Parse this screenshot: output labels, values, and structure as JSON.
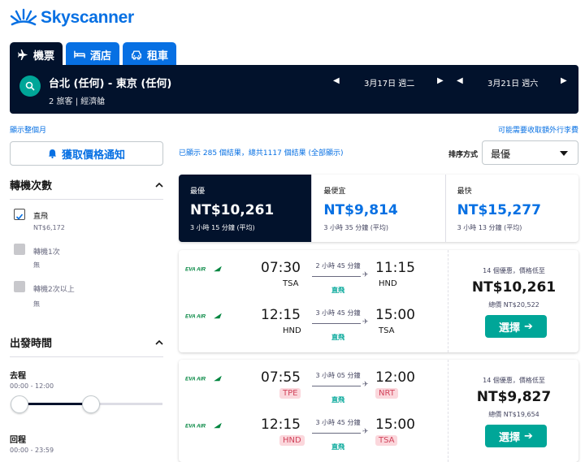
{
  "brand": {
    "name": "Skyscanner"
  },
  "tabs": [
    {
      "label": "機票",
      "icon": "plane-icon"
    },
    {
      "label": "酒店",
      "icon": "bed-icon"
    },
    {
      "label": "租車",
      "icon": "car-icon"
    }
  ],
  "search": {
    "route": "台北 (任何) - 東京 (任何)",
    "passengers": "2 旅客 | 經濟艙",
    "depart_date": "3月17日 週二",
    "return_date": "3月21日 週六"
  },
  "links": {
    "month_view": "顯示整個月",
    "extra_fees": "可能需要收取額外行李費"
  },
  "sidebar": {
    "price_alert": "獲取價格通知",
    "stops": {
      "title": "轉機次數",
      "options": [
        {
          "label": "直飛",
          "sub": "NT$6,172",
          "checked": true
        },
        {
          "label": "轉機1次",
          "sub": "無",
          "checked": false
        },
        {
          "label": "轉機2次以上",
          "sub": "無",
          "checked": false
        }
      ]
    },
    "times": {
      "title": "出發時間",
      "outbound_label": "去程",
      "outbound_range": "00:00 - 12:00",
      "outbound_fraction": 0.5,
      "return_label": "回程",
      "return_range": "00:00 - 23:59"
    }
  },
  "results": {
    "count_text": "已顯示 285 個結果，總共1117 個結果 (全部顯示)",
    "sort_label": "排序方式",
    "sort_value": "最優"
  },
  "summary": [
    {
      "label": "最優",
      "price": "NT$10,261",
      "duration": "3 小時 15 分鐘 (平均)",
      "active": true
    },
    {
      "label": "最便宜",
      "price": "NT$9,814",
      "duration": "3 小時 35 分鐘 (平均)",
      "active": false
    },
    {
      "label": "最快",
      "price": "NT$15,277",
      "duration": "3 小時 13 分鐘 (平均)",
      "active": false
    }
  ],
  "flights": [
    {
      "legs": [
        {
          "airline": "EVA AIR",
          "dep_time": "07:30",
          "dep_code": "TSA",
          "arr_time": "11:15",
          "arr_code": "HND",
          "duration": "2 小時 45 分鐘",
          "stops": "直飛",
          "dep_warn": false,
          "arr_warn": false
        },
        {
          "airline": "EVA AIR",
          "dep_time": "12:15",
          "dep_code": "HND",
          "arr_time": "15:00",
          "arr_code": "TSA",
          "duration": "3 小時 45 分鐘",
          "stops": "直飛",
          "dep_warn": false,
          "arr_warn": false
        }
      ],
      "deals": "14 個優惠，價格低至",
      "price": "NT$10,261",
      "total": "總價 NT$20,522",
      "button": "選擇"
    },
    {
      "legs": [
        {
          "airline": "EVA AIR",
          "dep_time": "07:55",
          "dep_code": "TPE",
          "arr_time": "12:00",
          "arr_code": "NRT",
          "duration": "3 小時 05 分鐘",
          "stops": "直飛",
          "dep_warn": true,
          "arr_warn": true
        },
        {
          "airline": "EVA AIR",
          "dep_time": "12:15",
          "dep_code": "HND",
          "arr_time": "15:00",
          "arr_code": "TSA",
          "duration": "3 小時 45 分鐘",
          "stops": "直飛",
          "dep_warn": true,
          "arr_warn": true
        }
      ],
      "deals": "14 個優惠，價格低至",
      "price": "NT$9,827",
      "total": "總價 NT$19,654",
      "button": "選擇"
    }
  ],
  "colors": {
    "brand_blue": "#0770e3",
    "navy": "#02122c",
    "teal": "#00a698",
    "warn_bg": "#fbd7dc",
    "eva_green": "#00853f"
  }
}
